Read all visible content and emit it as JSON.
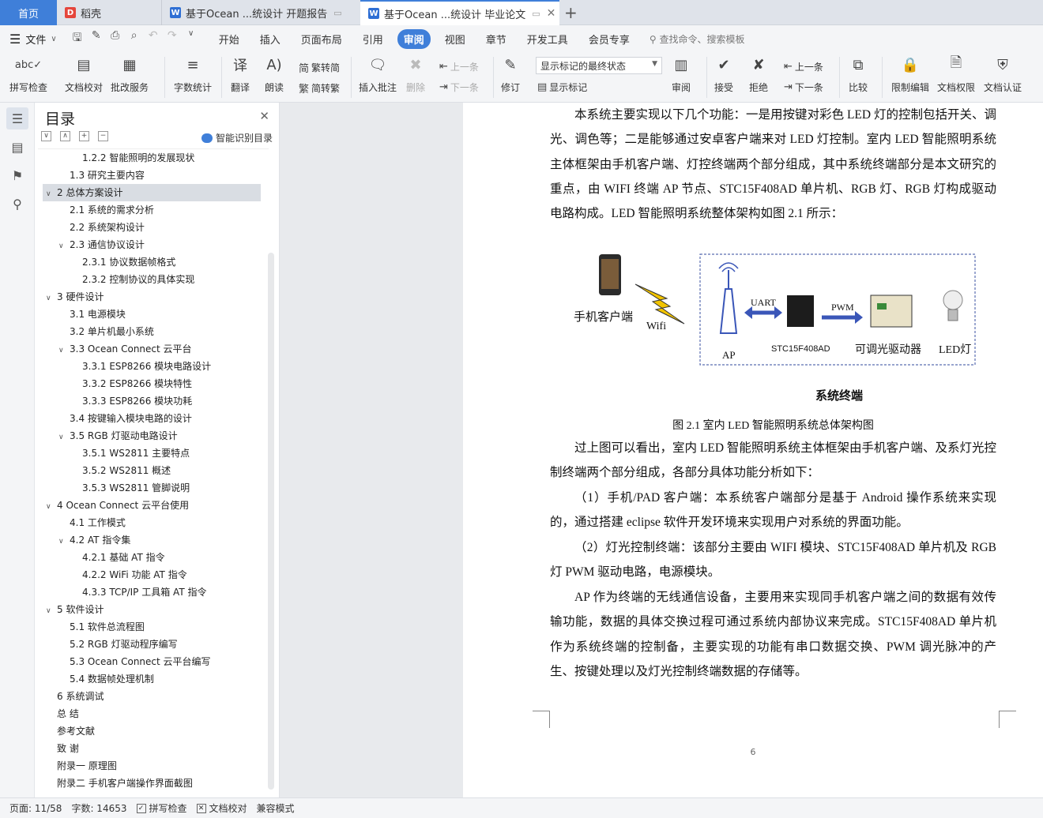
{
  "tabs": {
    "home": "首页",
    "wps": "稻壳",
    "doc1": "基于Ocean ...统设计 开题报告",
    "doc2": "基于Ocean ...统设计 毕业论文"
  },
  "menubar": {
    "file": "文件",
    "items": [
      "开始",
      "插入",
      "页面布局",
      "引用",
      "审阅",
      "视图",
      "章节",
      "开发工具",
      "会员专享"
    ],
    "search": "查找命令、搜索模板"
  },
  "ribbon": {
    "spellcheck": "拼写检查",
    "doc_proof": "文档校对",
    "batch_revise": "批改服务",
    "word_count": "字数统计",
    "translate": "翻译",
    "read_aloud": "朗读",
    "trad_to_simp": "繁转简",
    "simp_to_trad": "简转繁",
    "insert_comment": "插入批注",
    "delete": "删除",
    "prev_comment": "上一条",
    "next_comment": "下一条",
    "revise": "修订",
    "markup_state": "显示标记的最终状态",
    "show_markup": "显示标记",
    "review": "审阅",
    "accept": "接受",
    "reject": "拒绝",
    "prev_change": "上一条",
    "next_change": "下一条",
    "compare": "比较",
    "restrict_edit": "限制编辑",
    "doc_rights": "文档权限",
    "doc_cert": "文档认证"
  },
  "toc": {
    "title": "目录",
    "ai_label": "智能识别目录",
    "items": [
      {
        "label": "1.2.2 智能照明的发展现状",
        "level": 3,
        "caret": ""
      },
      {
        "label": "1.3  研究主要内容",
        "level": 2,
        "caret": ""
      },
      {
        "label": "2  总体方案设计",
        "level": 1,
        "caret": "v",
        "selected": true
      },
      {
        "label": "2.1  系统的需求分析",
        "level": 2,
        "caret": ""
      },
      {
        "label": "2.2  系统架构设计",
        "level": 2,
        "caret": ""
      },
      {
        "label": "2.3  通信协议设计",
        "level": 2,
        "caret": "v"
      },
      {
        "label": "2.3.1 协议数据帧格式",
        "level": 3,
        "caret": ""
      },
      {
        "label": "2.3.2 控制协议的具体实现",
        "level": 3,
        "caret": ""
      },
      {
        "label": "3  硬件设计",
        "level": 1,
        "caret": "v"
      },
      {
        "label": "3.1  电源模块",
        "level": 2,
        "caret": ""
      },
      {
        "label": "3.2  单片机最小系统",
        "level": 2,
        "caret": ""
      },
      {
        "label": "3.3 Ocean Connect 云平台",
        "level": 2,
        "caret": "v"
      },
      {
        "label": "3.3.1 ESP8266 模块电路设计",
        "level": 3,
        "caret": ""
      },
      {
        "label": "3.3.2 ESP8266 模块特性",
        "level": 3,
        "caret": ""
      },
      {
        "label": "3.3.3 ESP8266 模块功耗",
        "level": 3,
        "caret": ""
      },
      {
        "label": "3.4  按键输入模块电路的设计",
        "level": 2,
        "caret": ""
      },
      {
        "label": "3.5 RGB  灯驱动电路设计",
        "level": 2,
        "caret": "v"
      },
      {
        "label": "3.5.1 WS2811  主要特点",
        "level": 3,
        "caret": ""
      },
      {
        "label": "3.5.2 WS2811  概述",
        "level": 3,
        "caret": ""
      },
      {
        "label": "3.5.3 WS2811  管脚说明",
        "level": 3,
        "caret": ""
      },
      {
        "label": "4 Ocean Connect 云平台使用",
        "level": 1,
        "caret": "v"
      },
      {
        "label": "4.1  工作模式",
        "level": 2,
        "caret": ""
      },
      {
        "label": "4.2 AT 指令集",
        "level": 2,
        "caret": "v"
      },
      {
        "label": "4.2.1  基础 AT 指令",
        "level": 3,
        "caret": ""
      },
      {
        "label": "4.2.2 WiFi 功能 AT 指令",
        "level": 3,
        "caret": ""
      },
      {
        "label": "4.3.3 TCP/IP 工具箱  AT 指令",
        "level": 3,
        "caret": ""
      },
      {
        "label": "5  软件设计",
        "level": 1,
        "caret": "v"
      },
      {
        "label": "5.1 软件总流程图",
        "level": 2,
        "caret": ""
      },
      {
        "label": "5.2 RGB 灯驱动程序编写",
        "level": 2,
        "caret": ""
      },
      {
        "label": "5.3 Ocean Connect 云平台编写",
        "level": 2,
        "caret": ""
      },
      {
        "label": "5.4 数据帧处理机制",
        "level": 2,
        "caret": ""
      },
      {
        "label": "6  系统调试",
        "level": 1,
        "caret": ""
      },
      {
        "label": "总   结",
        "level": 1,
        "caret": ""
      },
      {
        "label": "参考文献",
        "level": 1,
        "caret": ""
      },
      {
        "label": "致   谢",
        "level": 1,
        "caret": ""
      },
      {
        "label": "附录一  原理图",
        "level": 1,
        "caret": ""
      },
      {
        "label": "附录二  手机客户端操作界面截图",
        "level": 1,
        "caret": ""
      }
    ]
  },
  "document": {
    "para1": "本系统主要实现以下几个功能：一是用按键对彩色 LED 灯的控制包括开关、调光、调色等；二是能够通过安卓客户端来对 LED 灯控制。室内 LED 智能照明系统主体框架由手机客户端、灯控终端两个部分组成，其中系统终端部分是本文研究的重点，由 WIFI 终端 AP 节点、STC15F408AD 单片机、RGB 灯、RGB 灯构成驱动电路构成。LED 智能照明系统整体架构如图 2.1 所示：",
    "figure": {
      "phone_label": "手机客户端",
      "wifi_label": "Wifi",
      "ap_label": "AP",
      "uart_label": "UART",
      "mcu_label": "STC15F408AD",
      "pwm_label": "PWM",
      "driver_label": "可调光驱动器",
      "led_label": "LED灯",
      "terminal_label": "系统终端"
    },
    "caption": "图 2.1  室内 LED 智能照明系统总体架构图",
    "para2": "过上图可以看出，室内 LED 智能照明系统主体框架由手机客户端、及系灯光控制终端两个部分组成，各部分具体功能分析如下：",
    "para3": "（1）手机/PAD 客户端：本系统客户端部分是基于 Android 操作系统来实现的，通过搭建 eclipse 软件开发环境来实现用户对系统的界面功能。",
    "para4": "（2）灯光控制终端：该部分主要由 WIFI 模块、STC15F408AD 单片机及 RGB 灯 PWM 驱动电路，电源模块。",
    "para5": "AP 作为终端的无线通信设备，主要用来实现同手机客户端之间的数据有效传输功能，数据的具体交换过程可通过系统内部协议来完成。STC15F408AD 单片机作为系统终端的控制备，主要实现的功能有串口数据交换、PWM 调光脉冲的产生、按键处理以及灯光控制终端数据的存储等。",
    "page_number": "6"
  },
  "statusbar": {
    "page": "页面: 11/58",
    "words": "字数: 14653",
    "spellcheck": "拼写检查",
    "proof": "文档校对",
    "compat": "兼容模式"
  },
  "colors": {
    "accent": "#3f7fd9",
    "tab_bg": "#dfe3ea",
    "toc_selected": "#d9dde3"
  }
}
